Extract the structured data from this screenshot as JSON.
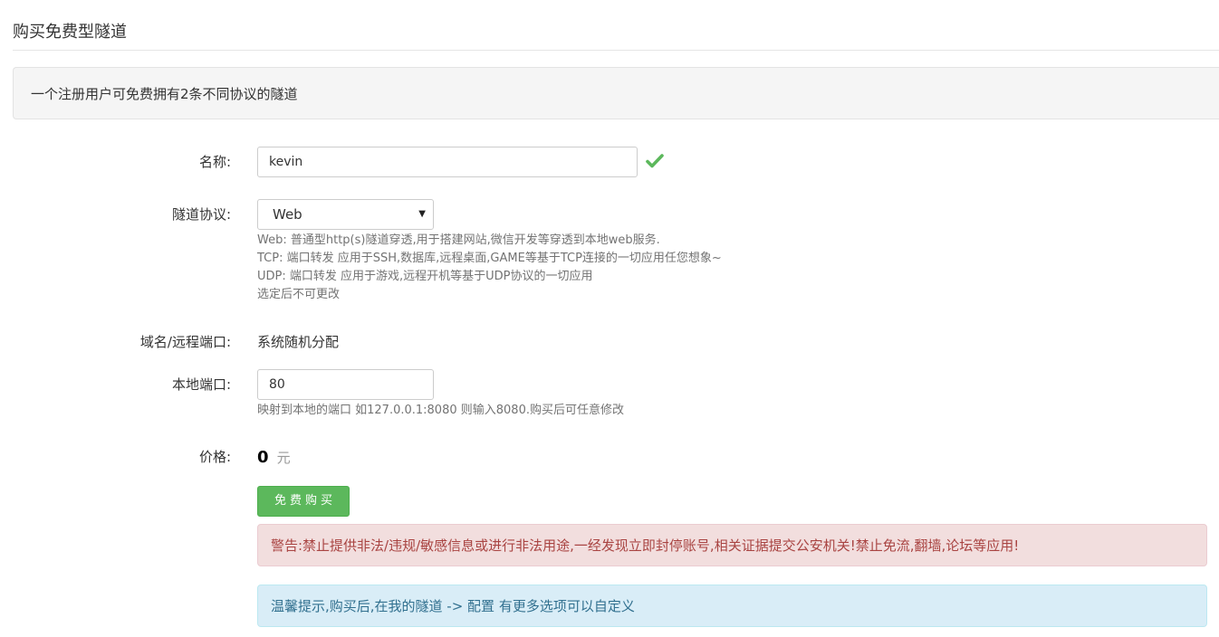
{
  "page": {
    "title": "购买免费型隧道"
  },
  "notice": {
    "text": "一个注册用户可免费拥有2条不同协议的隧道"
  },
  "form": {
    "name": {
      "label": "名称:",
      "value": "kevin",
      "valid_icon": "check-icon"
    },
    "protocol": {
      "label": "隧道协议:",
      "selected": "Web",
      "help": [
        "Web: 普通型http(s)隧道穿透,用于搭建网站,微信开发等穿透到本地web服务.",
        "TCP: 端口转发 应用于SSH,数据库,远程桌面,GAME等基于TCP连接的一切应用任您想象~",
        "UDP: 端口转发 应用于游戏,远程开机等基于UDP协议的一切应用",
        "选定后不可更改"
      ]
    },
    "domain": {
      "label": "域名/远程端口:",
      "value": "系统随机分配"
    },
    "local_port": {
      "label": "本地端口:",
      "value": "80",
      "help": "映射到本地的端口 如127.0.0.1:8080 则输入8080.购买后可任意修改"
    },
    "price": {
      "label": "价格:",
      "amount": "0",
      "unit": "元"
    },
    "buy_button": {
      "label": "免费购买"
    }
  },
  "alerts": {
    "warning": "警告:禁止提供非法/违规/敏感信息或进行非法用途,一经发现立即封停账号,相关证据提交公安机关!禁止免流,翻墙,论坛等应用!",
    "tip": "温馨提示,购买后,在我的隧道 -> 配置 有更多选项可以自定义"
  },
  "colors": {
    "success": "#5cb85c",
    "check": "#5cb85c",
    "danger_bg": "#f2dede",
    "danger_text": "#a94442",
    "info_bg": "#d9edf7",
    "info_text": "#31708f"
  }
}
